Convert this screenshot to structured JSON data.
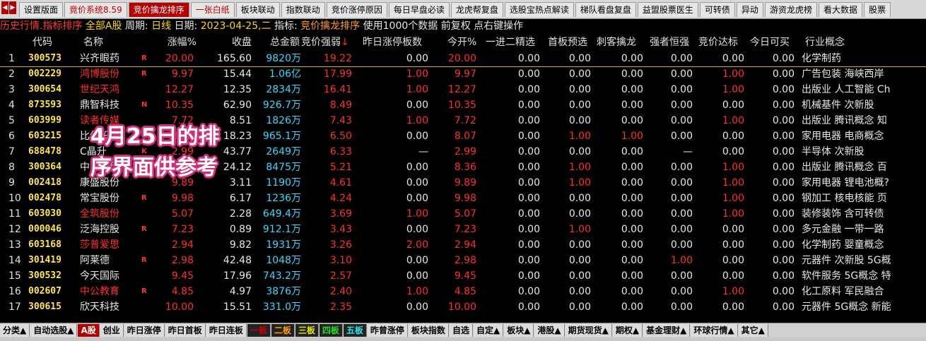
{
  "top_tabs": [
    {
      "label": "设置版面",
      "style": "normal"
    },
    {
      "label": "竟价系统8.59",
      "style": "red-text"
    },
    {
      "label": "竞价擒龙排序",
      "style": "active"
    },
    {
      "label": "一张白纸",
      "style": "red-text"
    },
    {
      "label": "板块联动",
      "style": "normal"
    },
    {
      "label": "指数联动",
      "style": "normal"
    },
    {
      "label": "竞价涨停原因",
      "style": "normal"
    },
    {
      "label": "每日早盘必读",
      "style": "normal"
    },
    {
      "label": "龙虎帮复盘",
      "style": "normal"
    },
    {
      "label": "选股宝热点解读",
      "style": "normal"
    },
    {
      "label": "梯队看盘复盘",
      "style": "normal"
    },
    {
      "label": "益盟股票医生",
      "style": "normal"
    },
    {
      "label": "可转债",
      "style": "normal"
    },
    {
      "label": "异动",
      "style": "normal"
    },
    {
      "label": "游资龙虎榜",
      "style": "normal"
    },
    {
      "label": "看大数据",
      "style": "normal"
    },
    {
      "label": "股票",
      "style": "normal"
    }
  ],
  "info": {
    "history": "历史行情.指标排序",
    "market": "全部A股",
    "period_label": "周期:",
    "period": "日线",
    "date_label": "日期:",
    "date": "2023-04-25,二",
    "indicator_label": "指标:",
    "indicator": "竞价擒龙排序",
    "usage": "使用1000个数据 前复权 点右键操作"
  },
  "headers": {
    "code": "代码",
    "name": "名称",
    "change": "涨幅%",
    "close": "收盘",
    "amount": "总金额",
    "strength": "竞价强弱",
    "sort_arrow": "↓",
    "prev_limit": "昨日涨停板数",
    "open": "今开%",
    "c1": "一进二精选",
    "c2": "首板预选",
    "c3": "刺客擒龙",
    "c4": "强者恒强",
    "c5": "竞价达标",
    "c6": "今日可买",
    "c7": "行业概念"
  },
  "rows": [
    {
      "idx": "1",
      "code": "300573",
      "name": "兴齐眼药",
      "name_red": false,
      "flag": "R",
      "change": "20.00",
      "close": "165.60",
      "amount": "9820万",
      "strength": "19.22",
      "prev": "0.00",
      "prev_red": false,
      "open": "20.00",
      "c1": "0.00",
      "c1r": false,
      "c2": "0.00",
      "c2r": false,
      "c3": "0.00",
      "c3r": false,
      "c4": "0.00",
      "c4r": false,
      "c5": "0.00",
      "c5r": false,
      "c6": "0.00",
      "concept": "化学制药"
    },
    {
      "idx": "2",
      "code": "002229",
      "name": "鸿博股份",
      "name_red": true,
      "flag": "R",
      "change": "9.97",
      "close": "15.44",
      "amount": "1.06亿",
      "strength": "17.99",
      "prev": "1.00",
      "prev_red": true,
      "open": "9.97",
      "c1": "0.00",
      "c1r": false,
      "c2": "0.00",
      "c2r": false,
      "c3": "0.00",
      "c3r": false,
      "c4": "0.00",
      "c4r": false,
      "c5": "1.00",
      "c5r": true,
      "c6": "0.00",
      "concept": "广告包装  海峡西岸"
    },
    {
      "idx": "3",
      "code": "300654",
      "name": "世纪天鸿",
      "name_red": true,
      "flag": "",
      "change": "12.27",
      "close": "12.35",
      "amount": "2834万",
      "strength": "16.41",
      "prev": "1.00",
      "prev_red": true,
      "open": "12.27",
      "c1": "0.00",
      "c1r": false,
      "c2": "0.00",
      "c2r": false,
      "c3": "0.00",
      "c3r": false,
      "c4": "0.00",
      "c4r": false,
      "c5": "1.00",
      "c5r": true,
      "c6": "0.00",
      "concept": "出版业  人工智能 Ch"
    },
    {
      "idx": "4",
      "code": "873593",
      "name": "鼎智科技",
      "name_red": false,
      "flag": "N",
      "change": "10.35",
      "close": "62.90",
      "amount": "926.7万",
      "strength": "8.49",
      "prev": "0.00",
      "prev_red": false,
      "open": "10.35",
      "c1": "0.00",
      "c1r": false,
      "c2": "0.00",
      "c2r": false,
      "c3": "0.00",
      "c3r": false,
      "c4": "0.00",
      "c4r": false,
      "c5": "0.00",
      "c5r": false,
      "c6": "0.00",
      "concept": "机械基件  次新股"
    },
    {
      "idx": "5",
      "code": "603999",
      "name": "读者传媒",
      "name_red": true,
      "flag": "",
      "change": "7.72",
      "close": "8.51",
      "amount": "1826万",
      "strength": "7.43",
      "prev": "1.00",
      "prev_red": true,
      "open": "7.72",
      "c1": "0.00",
      "c1r": false,
      "c2": "0.00",
      "c2r": false,
      "c3": "0.00",
      "c3r": false,
      "c4": "0.00",
      "c4r": false,
      "c5": "1.00",
      "c5r": true,
      "c6": "0.00",
      "concept": "出版业  腾讯概念 知"
    },
    {
      "idx": "6",
      "code": "603215",
      "name": "比依股份",
      "name_red": false,
      "flag": "",
      "change": "8.07",
      "close": "18.23",
      "amount": "965.1万",
      "strength": "6.50",
      "prev": "0.00",
      "prev_red": false,
      "open": "8.07",
      "c1": "0.00",
      "c1r": false,
      "c2": "1.00",
      "c2r": true,
      "c3": "1.00",
      "c3r": true,
      "c4": "0.00",
      "c4r": false,
      "c5": "0.00",
      "c5r": false,
      "c6": "0.00",
      "concept": "家用电器  电商概念"
    },
    {
      "idx": "7",
      "code": "688478",
      "name": "C晶升",
      "name_red": false,
      "flag": "K",
      "change": "2.99",
      "close": "43.77",
      "amount": "2649万",
      "strength": "6.33",
      "prev": "—",
      "prev_red": false,
      "open": "2.99",
      "c1": "0.00",
      "c1r": false,
      "c2": "0.00",
      "c2r": false,
      "c3": "0.00",
      "c3r": false,
      "c4": "—",
      "c4r": false,
      "c5": "0.00",
      "c5r": false,
      "c6": "0.00",
      "concept": "半导体  次新股"
    },
    {
      "idx": "8",
      "code": "300364",
      "name": "中文在线",
      "name_red": false,
      "flag": "",
      "change": "8.36",
      "close": "24.12",
      "amount": "8475万",
      "strength": "5.21",
      "prev": "0.00",
      "prev_red": false,
      "open": "8.36",
      "c1": "0.00",
      "c1r": false,
      "c2": "1.00",
      "c2r": true,
      "c3": "0.00",
      "c3r": false,
      "c4": "0.00",
      "c4r": false,
      "c5": "1.00",
      "c5r": true,
      "c6": "0.00",
      "concept": "出版业  腾讯概念 百"
    },
    {
      "idx": "9",
      "code": "002418",
      "name": "康盛股份",
      "name_red": false,
      "flag": "",
      "change": "9.89",
      "close": "3.11",
      "amount": "1190万",
      "strength": "4.61",
      "prev": "0.00",
      "prev_red": false,
      "open": "9.89",
      "c1": "0.00",
      "c1r": false,
      "c2": "1.00",
      "c2r": true,
      "c3": "0.00",
      "c3r": false,
      "c4": "0.00",
      "c4r": false,
      "c5": "1.00",
      "c5r": true,
      "c6": "0.00",
      "concept": "家用电器  锂电池概?"
    },
    {
      "idx": "10",
      "code": "002478",
      "name": "常宝股份",
      "name_red": false,
      "flag": "R",
      "change": "9.98",
      "close": "6.17",
      "amount": "1236万",
      "strength": "4.24",
      "prev": "0.00",
      "prev_red": false,
      "open": "9.98",
      "c1": "0.00",
      "c1r": false,
      "c2": "0.00",
      "c2r": false,
      "c3": "0.00",
      "c3r": false,
      "c4": "0.00",
      "c4r": false,
      "c5": "1.00",
      "c5r": true,
      "c6": "0.00",
      "concept": "钢加工  核电核能 页"
    },
    {
      "idx": "11",
      "code": "603030",
      "name": "全筑股份",
      "name_red": true,
      "flag": "",
      "change": "5.07",
      "close": "2.28",
      "amount": "649.4万",
      "strength": "3.69",
      "prev": "1.00",
      "prev_red": true,
      "open": "5.07",
      "c1": "0.00",
      "c1r": false,
      "c2": "0.00",
      "c2r": false,
      "c3": "0.00",
      "c3r": false,
      "c4": "0.00",
      "c4r": false,
      "c5": "1.00",
      "c5r": true,
      "c6": "0.00",
      "concept": "装修装饰  含可转债"
    },
    {
      "idx": "12",
      "code": "000046",
      "name": "泛海控股",
      "name_red": false,
      "flag": "R",
      "change": "7.23",
      "close": "0.89",
      "amount": "912.1万",
      "strength": "3.43",
      "prev": "0.00",
      "prev_red": false,
      "open": "7.23",
      "c1": "0.00",
      "c1r": false,
      "c2": "1.00",
      "c2r": true,
      "c3": "0.00",
      "c3r": false,
      "c4": "0.00",
      "c4r": false,
      "c5": "0.00",
      "c5r": false,
      "c6": "0.00",
      "concept": "多元金融  一带一路"
    },
    {
      "idx": "13",
      "code": "603168",
      "name": "莎普爱思",
      "name_red": true,
      "flag": "",
      "change": "2.94",
      "close": "9.82",
      "amount": "1931万",
      "strength": "3.26",
      "prev": "2.00",
      "prev_red": true,
      "open": "2.94",
      "c1": "0.00",
      "c1r": false,
      "c2": "0.00",
      "c2r": false,
      "c3": "0.00",
      "c3r": false,
      "c4": "0.00",
      "c4r": false,
      "c5": "0.00",
      "c5r": false,
      "c6": "0.00",
      "concept": "化学制药  婴童概念"
    },
    {
      "idx": "14",
      "code": "301419",
      "name": "阿莱德",
      "name_red": false,
      "flag": "R",
      "change": "2.98",
      "close": "42.48",
      "amount": "1048万",
      "strength": "3.10",
      "prev": "0.00",
      "prev_red": false,
      "open": "2.98",
      "c1": "0.00",
      "c1r": false,
      "c2": "0.00",
      "c2r": false,
      "c3": "0.00",
      "c3r": false,
      "c4": "1.00",
      "c4r": true,
      "c5": "0.00",
      "c5r": false,
      "c6": "0.00",
      "concept": "元器件  次新股 5G概"
    },
    {
      "idx": "15",
      "code": "300532",
      "name": "今天国际",
      "name_red": false,
      "flag": "",
      "change": "9.45",
      "close": "17.96",
      "amount": "743.2万",
      "strength": "2.57",
      "prev": "0.00",
      "prev_red": false,
      "open": "9.45",
      "c1": "0.00",
      "c1r": false,
      "c2": "0.00",
      "c2r": false,
      "c3": "0.00",
      "c3r": false,
      "c4": "0.00",
      "c4r": false,
      "c5": "0.00",
      "c5r": false,
      "c6": "0.00",
      "concept": "软件服务  5G概念 特"
    },
    {
      "idx": "16",
      "code": "002607",
      "name": "中公教育",
      "name_red": true,
      "flag": "R",
      "change": "4.85",
      "close": "4.97",
      "amount": "3876万",
      "strength": "2.40",
      "prev": "1.00",
      "prev_red": true,
      "open": "4.85",
      "c1": "0.00",
      "c1r": false,
      "c2": "0.00",
      "c2r": false,
      "c3": "0.00",
      "c3r": false,
      "c4": "0.00",
      "c4r": false,
      "c5": "1.00",
      "c5r": true,
      "c6": "0.00",
      "concept": "化工原料  军民融合"
    },
    {
      "idx": "17",
      "code": "300615",
      "name": "欣天科技",
      "name_red": false,
      "flag": "",
      "change": "10.00",
      "close": "15.51",
      "amount": "331.0万",
      "strength": "2.35",
      "prev": "0.00",
      "prev_red": false,
      "open": "10.00",
      "c1": "0.00",
      "c1r": false,
      "c2": "0.00",
      "c2r": false,
      "c3": "0.00",
      "c3r": false,
      "c4": "0.00",
      "c4r": false,
      "c5": "0.00",
      "c5r": false,
      "c6": "0.00",
      "concept": "元器件  5G概念 新能"
    }
  ],
  "overlay": {
    "line1": "4月25日的排",
    "line2": "序界面供参考"
  },
  "bottom_tabs": [
    {
      "label": "分类▲",
      "style": "normal"
    },
    {
      "label": "自动选股▲",
      "style": "normal"
    },
    {
      "label": "A股",
      "style": "active"
    },
    {
      "label": "创业",
      "style": "normal"
    },
    {
      "label": "昨日涨停",
      "style": "normal"
    },
    {
      "label": "昨日首板",
      "style": "normal"
    },
    {
      "label": "昨日连板",
      "style": "normal"
    },
    {
      "label": "一板",
      "style": "c-red-t"
    },
    {
      "label": "二板",
      "style": "c-or-t"
    },
    {
      "label": "三板",
      "style": "c-yel-t"
    },
    {
      "label": "四板",
      "style": "c-grn-t"
    },
    {
      "label": "五板",
      "style": "c-cy-t"
    },
    {
      "label": "昨曾涨停",
      "style": "normal"
    },
    {
      "label": "板块指数",
      "style": "normal"
    },
    {
      "label": "自选",
      "style": "normal"
    },
    {
      "label": "自定▲",
      "style": "normal"
    },
    {
      "label": "板块▲",
      "style": "normal"
    },
    {
      "label": "港股▲",
      "style": "normal"
    },
    {
      "label": "期货现货▲",
      "style": "normal"
    },
    {
      "label": "期权▲",
      "style": "normal"
    },
    {
      "label": "基金理财▲",
      "style": "normal"
    },
    {
      "label": "环球行情▲",
      "style": "normal"
    },
    {
      "label": "其它▲",
      "style": "normal"
    }
  ]
}
